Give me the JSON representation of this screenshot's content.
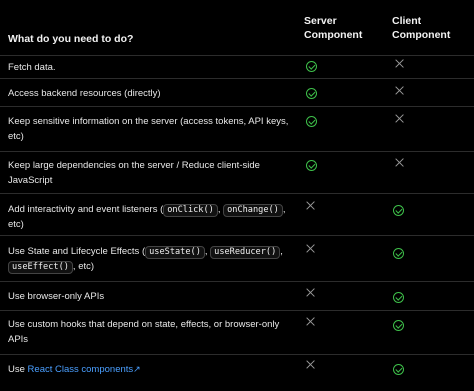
{
  "header": {
    "question": "What do you need to do?",
    "col_server": "Server Component",
    "col_client": "Client Component"
  },
  "rows": [
    {
      "text": "Fetch data.",
      "server": "check",
      "client": "cross"
    },
    {
      "text": "Access backend resources (directly)",
      "server": "check",
      "client": "cross"
    },
    {
      "text": "Keep sensitive information on the server (access tokens, API keys, etc)",
      "server": "check",
      "client": "cross"
    },
    {
      "text": "Keep large dependencies on the server / Reduce client-side JavaScript",
      "server": "check",
      "client": "cross"
    },
    {
      "text_prefix": "Add interactivity and event listeners (",
      "codes": [
        "onClick()",
        "onChange()"
      ],
      "text_suffix": "etc)",
      "server": "cross",
      "client": "check"
    },
    {
      "text_prefix": "Use State and Lifecycle Effects (",
      "codes": [
        "useState()",
        "useReducer()",
        "useEffect()"
      ],
      "text_suffix": "etc)",
      "server": "cross",
      "client": "check"
    },
    {
      "text": "Use browser-only APIs",
      "server": "cross",
      "client": "check"
    },
    {
      "text": "Use custom hooks that depend on state, effects, or browser-only APIs",
      "server": "cross",
      "client": "check"
    },
    {
      "text_prefix": "Use",
      "link": "React Class components",
      "link_icon": "↗",
      "server": "cross",
      "client": "check"
    }
  ],
  "icons": {
    "check": "check-circle-icon",
    "cross": "cross-icon"
  },
  "colors": {
    "background": "#000000",
    "check": "#3ec04a",
    "cross": "#9a9a9a",
    "link": "#4a9fff",
    "divider": "#2c2c2c"
  }
}
